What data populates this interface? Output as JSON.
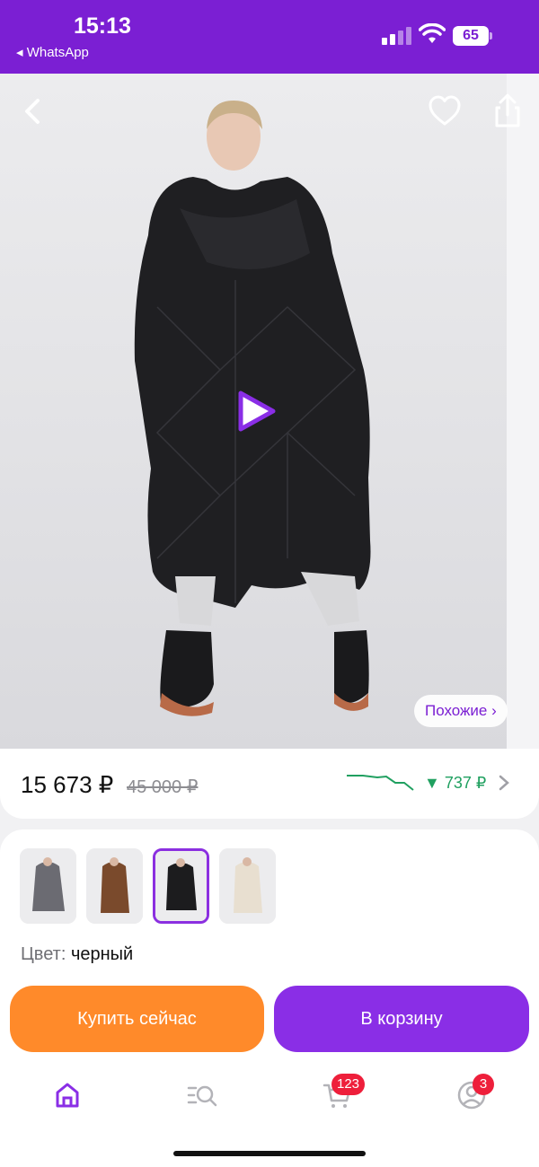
{
  "status_bar": {
    "time": "15:13",
    "back_app": "◂ WhatsApp",
    "battery": "65"
  },
  "hero": {
    "similar_label": "Похожие ›"
  },
  "price": {
    "current": "15 673 ₽",
    "old": "45 000 ₽",
    "drop": "▼ 737 ₽"
  },
  "variants": {
    "thumbnails": [
      {
        "name": "gray",
        "color": "#6b6b72"
      },
      {
        "name": "brown",
        "color": "#7a4a2c"
      },
      {
        "name": "black",
        "color": "#1c1c1e",
        "selected": true
      },
      {
        "name": "cream",
        "color": "#e8dfd0"
      }
    ],
    "color_label": "Цвет:",
    "color_value": "черный"
  },
  "actions": {
    "buy_now": "Купить сейчас",
    "add_to_cart": "В корзину"
  },
  "tabbar": {
    "cart_badge": "123",
    "profile_badge": "3"
  },
  "colors": {
    "brand": "#7b1fd3",
    "buy": "#ff8a2a",
    "cart": "#8a2ee6",
    "badge": "#ee1f3b",
    "price_drop": "#20a060"
  }
}
